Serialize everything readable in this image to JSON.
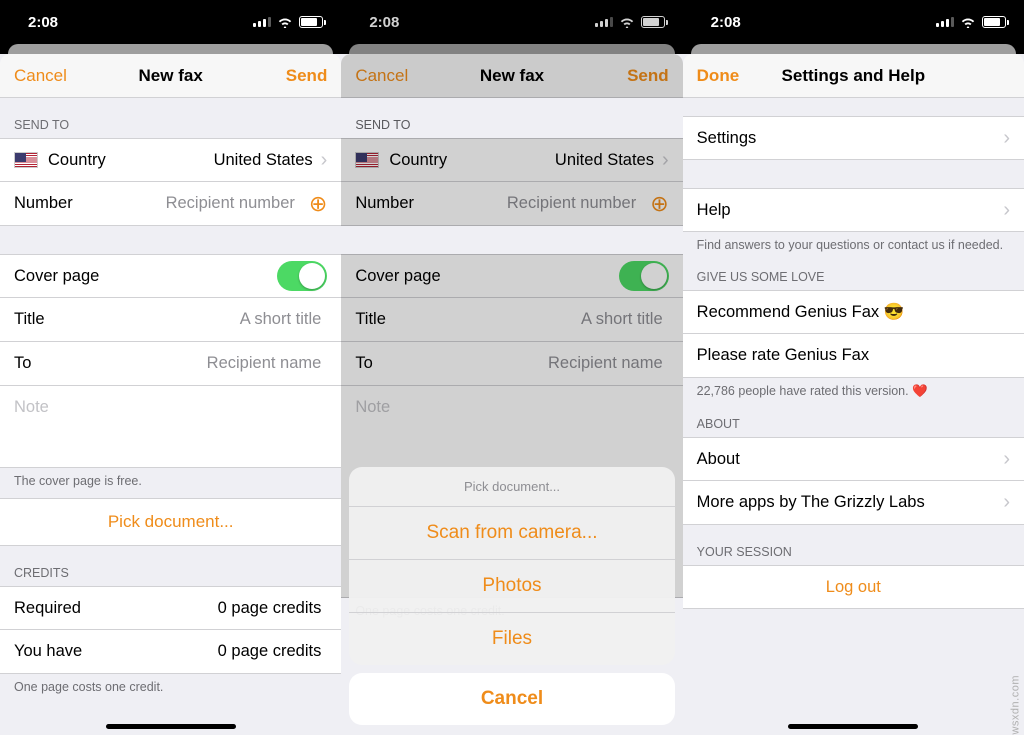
{
  "statusbar": {
    "time": "2:08"
  },
  "screen1": {
    "nav": {
      "left": "Cancel",
      "title": "New fax",
      "right": "Send"
    },
    "sendto_header": "SEND TO",
    "country_label": "Country",
    "country_value": "United States",
    "number_label": "Number",
    "number_placeholder": "Recipient number",
    "cover_label": "Cover page",
    "title_label": "Title",
    "title_placeholder": "A short title",
    "to_label": "To",
    "to_placeholder": "Recipient name",
    "note_placeholder": "Note",
    "cover_footer": "The cover page is free.",
    "pick_document": "Pick document...",
    "credits_header": "CREDITS",
    "required_label": "Required",
    "required_value": "0 page credits",
    "youhave_label": "You have",
    "youhave_value": "0 page credits",
    "credits_footer": "One page costs one credit."
  },
  "screen2": {
    "nav": {
      "left": "Cancel",
      "title": "New fax",
      "right": "Send"
    },
    "sendto_header": "SEND TO",
    "country_label": "Country",
    "country_value": "United States",
    "number_label": "Number",
    "number_placeholder": "Recipient number",
    "cover_label": "Cover page",
    "title_label": "Title",
    "title_placeholder": "A short title",
    "to_label": "To",
    "to_placeholder": "Recipient name",
    "note_placeholder": "Note",
    "credits_footer": "One page costs one credit.",
    "actionsheet": {
      "title": "Pick document...",
      "scan": "Scan from camera...",
      "photos": "Photos",
      "files": "Files",
      "cancel": "Cancel"
    }
  },
  "screen3": {
    "nav": {
      "left": "Done",
      "title": "Settings and Help"
    },
    "settings_label": "Settings",
    "help_label": "Help",
    "help_footer": "Find answers to your questions or contact us if needed.",
    "love_header": "GIVE US SOME LOVE",
    "recommend_label": "Recommend Genius Fax 😎",
    "rate_label": "Please rate Genius Fax",
    "rate_footer": "22,786 people have rated this version. ❤️",
    "about_header": "ABOUT",
    "about_label": "About",
    "moreapps_label": "More apps by The Grizzly Labs",
    "session_header": "YOUR SESSION",
    "logout_label": "Log out"
  },
  "watermark": "wsxdn.com"
}
